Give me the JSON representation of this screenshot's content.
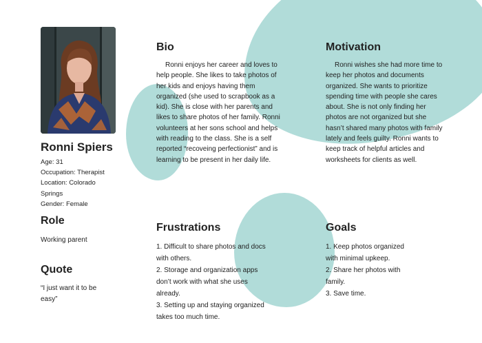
{
  "persona": {
    "name": "Ronni Spiers",
    "details": [
      "Age: 31",
      "Occupation: Therapist",
      "Location: Colorado Springs",
      "Gender: Female"
    ]
  },
  "role": {
    "heading": "Role",
    "text": "Working parent"
  },
  "quote": {
    "heading": "Quote",
    "text": "“I just want it to be easy”"
  },
  "bio": {
    "heading": "Bio",
    "text": "Ronni enjoys her career and loves to help people. She likes to take photos of her kids and enjoys having them organized (she used to scrapbook as a kid). She is close with her parents and likes to share photos of her family. Ronni volunteers at her sons school and helps with reading to the class. She is a self reported “recoveing perfectionist” and is learning to be present in her daily life."
  },
  "motivation": {
    "heading": "Motivation",
    "text": "Ronni wishes she had more time to keep her photos and documents organized. She wants to prioritize spending time with people she cares about. She is not only finding her photos are not organized  but  she hasn’t shared many photos with family lately and feels guilty. Ronni wants to keep track of helpful articles and worksheets for clients as well."
  },
  "frustrations": {
    "heading": "Frustrations",
    "items": [
      "1. Difficult to share photos and docs with others.",
      "2. Storage and organization apps don’t work with what she uses already.",
      "3. Setting up  and staying organized takes too much time."
    ]
  },
  "goals": {
    "heading": "Goals",
    "items": [
      "1. Keep photos organized with minimal upkeep.",
      "2. Share her photos with family.",
      "3. Save time."
    ]
  },
  "colors": {
    "accent_blob": "#b1dcd9",
    "text": "#222222"
  }
}
